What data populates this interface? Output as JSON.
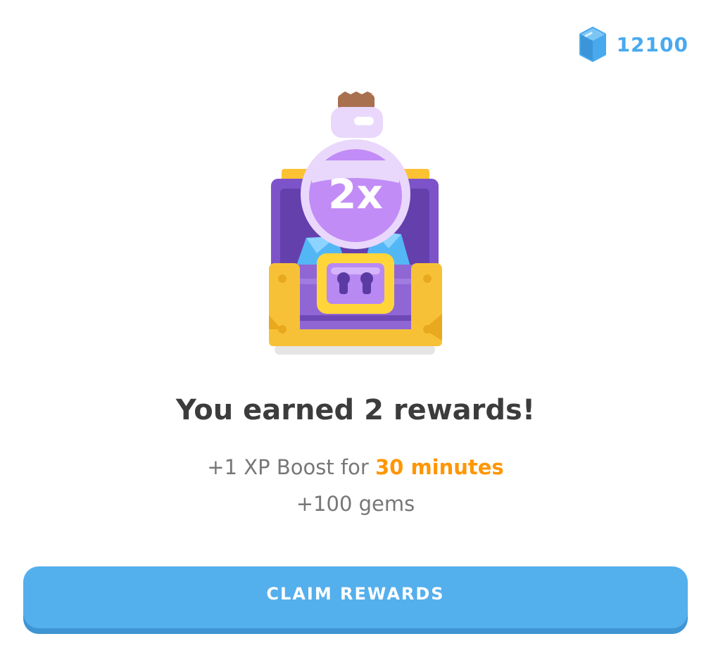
{
  "header": {
    "gem_icon": "gem-icon",
    "gem_count": "12100",
    "gem_color": "#49a9ee"
  },
  "illustration": {
    "icon": "treasure-chest-icon",
    "potion_icon": "xp-boost-potion-icon",
    "potion_label": "2x"
  },
  "rewards": {
    "title": "You earned 2 rewards!",
    "line1_prefix": "+1 XP Boost for ",
    "line1_highlight": "30 minutes",
    "line2": "+100 gems",
    "highlight_color": "#ff9600"
  },
  "actions": {
    "claim_label": "CLAIM REWARDS",
    "button_color": "#54afed",
    "button_shadow_color": "#3f94d2"
  }
}
